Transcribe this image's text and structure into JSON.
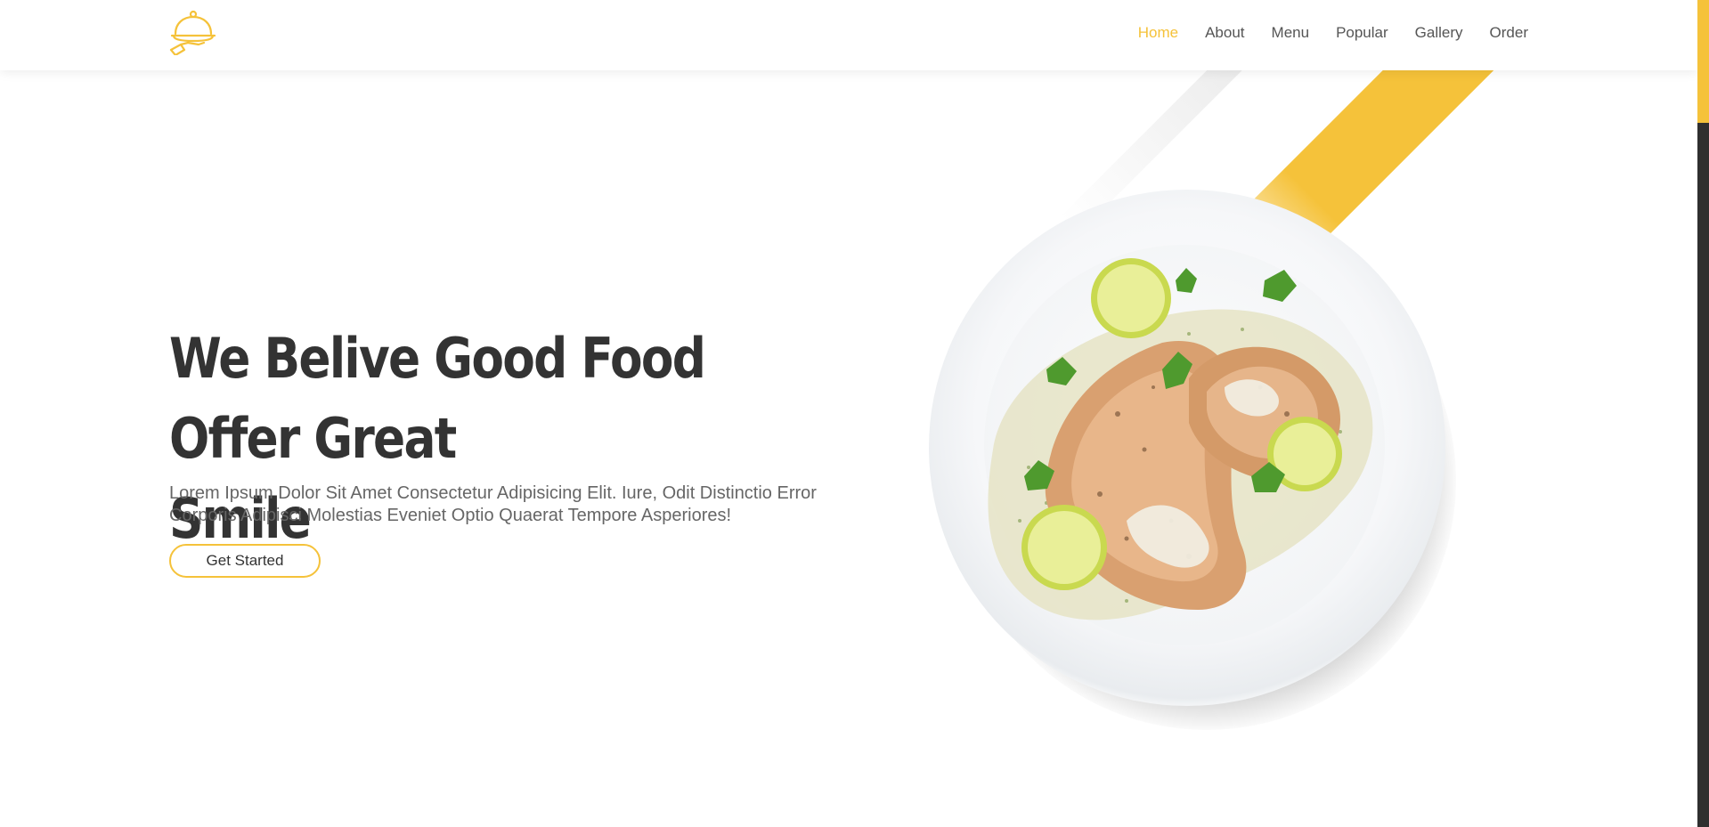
{
  "nav": {
    "items": [
      {
        "label": "Home",
        "active": true
      },
      {
        "label": "About",
        "active": false
      },
      {
        "label": "Menu",
        "active": false
      },
      {
        "label": "Popular",
        "active": false
      },
      {
        "label": "Gallery",
        "active": false
      },
      {
        "label": "Order",
        "active": false
      }
    ]
  },
  "logo": {
    "icon": "cloche-serving-icon"
  },
  "hero": {
    "title_line1": "We Belive Good Food Offer Great",
    "title_line2": "Smile",
    "description": "Lorem Ipsum Dolor Sit Amet Consectetur Adipisicing Elit. Iure, Odit Distinctio Error Corporis Adipisci Molestias Eveniet Optio Quaerat Tempore Asperiores!",
    "cta_label": "Get Started"
  },
  "colors": {
    "accent": "#f5c23a",
    "text_dark": "#333333",
    "text_muted": "#666666"
  }
}
